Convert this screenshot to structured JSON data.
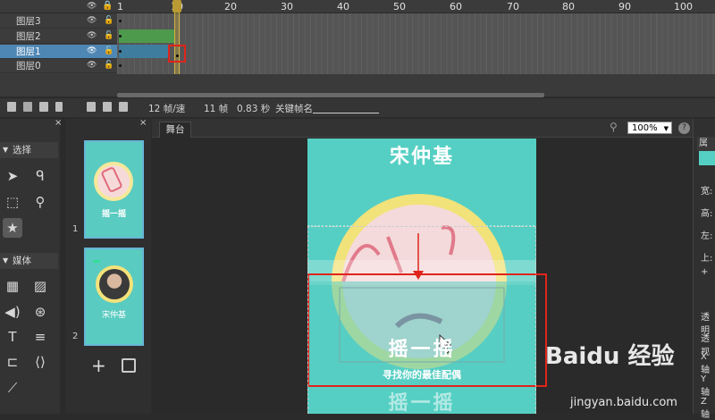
{
  "timeline": {
    "layers": [
      {
        "label": "图层3"
      },
      {
        "label": "图层2"
      },
      {
        "label": "图层1"
      },
      {
        "label": "图层0"
      }
    ],
    "ticks": [
      "1",
      "10",
      "20",
      "30",
      "40",
      "50",
      "60",
      "70",
      "80",
      "90",
      "100"
    ],
    "footer": {
      "fps": "12 帧/速",
      "frames": "11 帧",
      "seconds": "0.83 秒",
      "keyframe_label": "关键帧名"
    }
  },
  "tools": {
    "select_title": "选择",
    "media_title": "媒体",
    "text_tool": "T"
  },
  "pages": {
    "items": [
      {
        "num": "1",
        "caption": "摇一摇"
      },
      {
        "num": "2",
        "caption": "宋仲基"
      }
    ],
    "add_label": "+"
  },
  "stage": {
    "tab": "舞台",
    "zoom": "100%",
    "help": "?",
    "canvas_title": "宋仲基",
    "shake_text": "摇一摇",
    "sub_text": "寻找你的最佳配偶",
    "bottom_text": "摇一摇"
  },
  "props": {
    "header": "属性",
    "labels": [
      "宽:",
      "高:",
      "左:",
      "上:",
      "透明",
      "透视",
      "X轴",
      "Y轴",
      "Z轴"
    ]
  },
  "watermark": {
    "brand": "Baidu 经验",
    "url": "jingyan.baidu.com"
  },
  "colors": {
    "accent": "#4e87b4",
    "stage_bg": "#55cfc3",
    "highlight": "#e0241b"
  }
}
